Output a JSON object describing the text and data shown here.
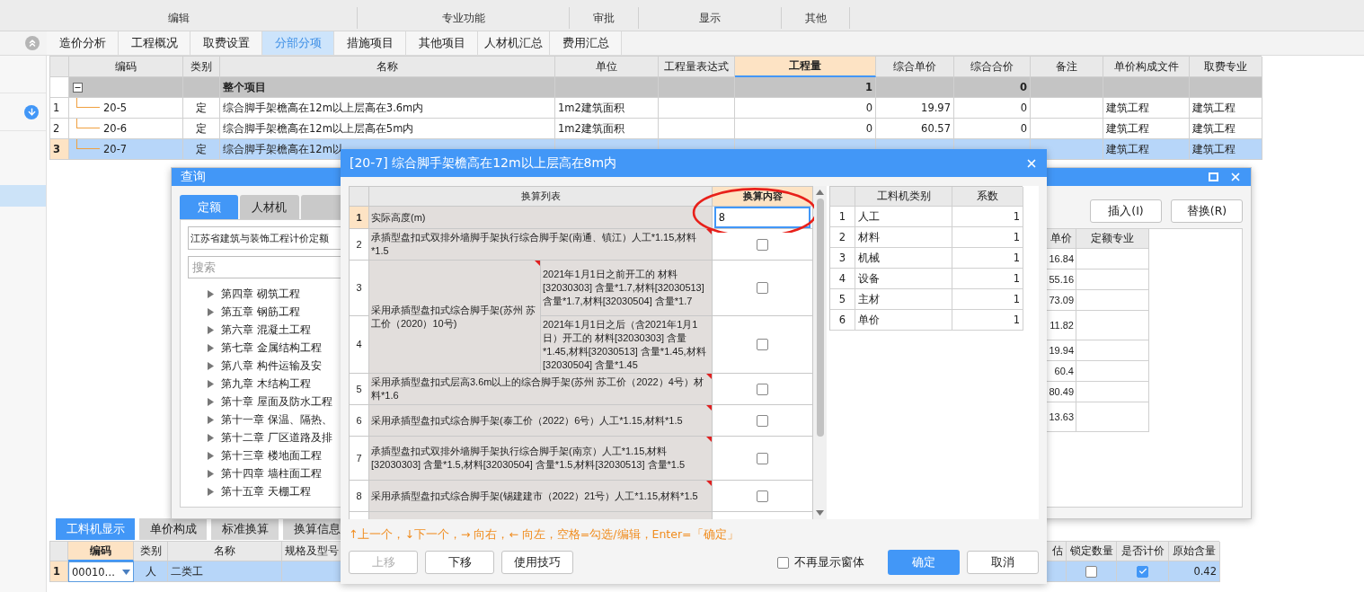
{
  "ribbon": {
    "groups": [
      {
        "label": "编辑"
      },
      {
        "label": "专业功能"
      },
      {
        "label": "审批"
      },
      {
        "label": "显示"
      },
      {
        "label": "其他"
      }
    ]
  },
  "tabs": [
    {
      "label": "造价分析",
      "selected": false
    },
    {
      "label": "工程概况",
      "selected": false
    },
    {
      "label": "取费设置",
      "selected": false
    },
    {
      "label": "分部分项",
      "selected": true
    },
    {
      "label": "措施项目",
      "selected": false
    },
    {
      "label": "其他项目",
      "selected": false
    },
    {
      "label": "人材机汇总",
      "selected": false
    },
    {
      "label": "费用汇总",
      "selected": false
    }
  ],
  "main_table": {
    "columns": [
      {
        "selected": false
      },
      {
        "label": "编码",
        "selected": false
      },
      {
        "label": "类别",
        "selected": false
      },
      {
        "label": "名称",
        "selected": false
      },
      {
        "label": "单位",
        "selected": false
      },
      {
        "label": "工程量表达式",
        "selected": false
      },
      {
        "label": "工程量",
        "selected": true
      },
      {
        "label": "综合单价",
        "selected": false
      },
      {
        "label": "综合合价",
        "selected": false
      },
      {
        "label": "备注",
        "selected": false
      },
      {
        "label": "单价构成文件",
        "selected": false
      },
      {
        "label": "取费专业",
        "selected": false
      }
    ],
    "total_row": {
      "label": "整个项目",
      "expanded": true,
      "quantity": "1",
      "total_price": "0"
    },
    "rows": [
      {
        "num": "1",
        "code": "20-5",
        "type": "定",
        "name": "综合脚手架檐高在12m以上层高在3.6m内",
        "unit": "1m2建筑面积",
        "quantity": "0",
        "unit_price": "19.97",
        "total_price": "0",
        "price_file": "建筑工程",
        "fee_type": "建筑工程",
        "selected": false
      },
      {
        "num": "2",
        "code": "20-6",
        "type": "定",
        "name": "综合脚手架檐高在12m以上层高在5m内",
        "unit": "1m2建筑面积",
        "quantity": "0",
        "unit_price": "60.57",
        "total_price": "0",
        "price_file": "建筑工程",
        "fee_type": "建筑工程",
        "selected": false
      },
      {
        "num": "3",
        "code": "20-7",
        "type": "定",
        "name": "综合脚手架檐高在12m以",
        "price_file": "建筑工程",
        "fee_type": "建筑工程",
        "selected": true
      }
    ]
  },
  "query_window": {
    "title": "查询",
    "tabs": [
      {
        "label": "定额",
        "selected": true
      },
      {
        "label": "人材机",
        "selected": false
      },
      {
        "selected": false
      }
    ],
    "library": "江苏省建筑与装饰工程计价定额",
    "search": {
      "placeholder": "搜索"
    },
    "tree": [
      {
        "label": "第四章 砌筑工程",
        "expanded": false
      },
      {
        "label": "第五章 钢筋工程",
        "expanded": false
      },
      {
        "label": "第六章 混凝土工程",
        "expanded": false
      },
      {
        "label": "第七章 金属结构工程",
        "expanded": false
      },
      {
        "label": "第八章 构件运输及安",
        "expanded": false
      },
      {
        "label": "第九章 木结构工程",
        "expanded": false
      },
      {
        "label": "第十章 屋面及防水工程",
        "expanded": false
      },
      {
        "label": "第十一章 保温、隔热、",
        "expanded": false
      },
      {
        "label": "第十二章 厂区道路及排",
        "expanded": false
      },
      {
        "label": "第十三章 楼地面工程",
        "expanded": false
      },
      {
        "label": "第十四章 墙柱面工程",
        "expanded": false
      },
      {
        "label": "第十五章 天棚工程",
        "expanded": false
      }
    ],
    "buttons": [
      "插入(I)",
      "替换(R)"
    ],
    "table": {
      "columns": [
        "单价",
        "定额专业"
      ],
      "rows": [
        {
          "unit_price": "16.84"
        },
        {
          "unit_price": "55.16"
        },
        {
          "unit_price": "73.09"
        },
        {
          "unit_price": "11.82"
        },
        {
          "unit_price": "19.94"
        },
        {
          "unit_price": "60.4"
        },
        {
          "unit_price": "80.49"
        },
        {
          "unit_price": "13.63"
        }
      ]
    }
  },
  "dialog": {
    "title": "[20-7] 综合脚手架檐高在12m以上层高在8m内",
    "columns": [
      {
        "label": "换算列表",
        "selected": false
      },
      {
        "label": "换算内容",
        "selected": true
      }
    ],
    "conversions": [
      {
        "kind": "input",
        "num": "1",
        "text": "实际高度(m)",
        "value": "8",
        "selected": true
      },
      {
        "kind": "check",
        "num": "2",
        "text": "承插型盘扣式双排外墙脚手架执行综合脚手架(南通、镇江）人工*1.15,材料*1.5",
        "checked": false,
        "selected": false
      },
      {
        "kind": "group",
        "text": "采用承插型盘扣式综合脚手架(苏州 苏工价（2020）10号)",
        "children": [
          {
            "num": "3",
            "text": "2021年1月1日之前开工的 材料[32030303] 含量*1.7,材料[32030513] 含量*1.7,材料[32030504] 含量*1.7",
            "checked": false,
            "selected": false
          },
          {
            "num": "4",
            "text": "2021年1月1日之后（含2021年1月1日）开工的 材料[32030303] 含量*1.45,材料[32030513] 含量*1.45,材料[32030504] 含量*1.45",
            "checked": false,
            "selected": false
          }
        ]
      },
      {
        "kind": "check",
        "num": "5",
        "text": "采用承插型盘扣式层高3.6m以上的综合脚手架(苏州 苏工价（2022）4号）材料*1.6",
        "checked": false,
        "selected": false
      },
      {
        "kind": "check",
        "num": "6",
        "text": "采用承插型盘扣式综合脚手架(泰工价（2022）6号）人工*1.15,材料*1.5",
        "checked": false,
        "selected": false
      },
      {
        "kind": "check",
        "num": "7",
        "text": "承插型盘扣式双排外墙脚手架执行综合脚手架(南京）人工*1.15,材料[32030303] 含量*1.5,材料[32030504] 含量*1.5,材料[32030513] 含量*1.5",
        "checked": false,
        "selected": false
      },
      {
        "kind": "check",
        "num": "8",
        "text": "采用承插型盘扣式综合脚手架(锡建建市（2022）21号）人工*1.15,材料*1.5",
        "checked": false,
        "selected": false
      }
    ],
    "factor_table": {
      "columns": [
        "工料机类别",
        "系数"
      ],
      "rows": [
        {
          "num": "1",
          "category": "人工",
          "factor": "1"
        },
        {
          "num": "2",
          "category": "材料",
          "factor": "1"
        },
        {
          "num": "3",
          "category": "机械",
          "factor": "1"
        },
        {
          "num": "4",
          "category": "设备",
          "factor": "1"
        },
        {
          "num": "5",
          "category": "主材",
          "factor": "1"
        },
        {
          "num": "6",
          "category": "单价",
          "factor": "1"
        }
      ]
    },
    "hint": "↑上一个，↓下一个，→ 向右，← 向左，空格=勾选/编辑，Enter=「确定」",
    "buttons": [
      {
        "label": "上移",
        "disabled": true
      },
      {
        "label": "下移",
        "disabled": false
      },
      {
        "label": "使用技巧",
        "disabled": false
      }
    ],
    "dont_show": {
      "label": "不再显示窗体",
      "checked": false
    },
    "confirm": "确定",
    "cancel": "取消"
  },
  "bottom_panel": {
    "tabs": [
      {
        "label": "工料机显示",
        "selected": true
      },
      {
        "label": "单价构成",
        "selected": false
      },
      {
        "label": "标准换算",
        "selected": false
      },
      {
        "label": "换算信息",
        "selected": false
      }
    ],
    "left_columns": [
      {
        "selected": false
      },
      {
        "label": "编码",
        "selected": true
      },
      {
        "label": "类别",
        "selected": false
      },
      {
        "label": "名称",
        "selected": false
      },
      {
        "label": "规格及型号",
        "selected": false
      }
    ],
    "right_columns": [
      "估",
      "锁定数量",
      "是否计价",
      "原始含量"
    ],
    "rows": [
      {
        "num": "1",
        "code": "00010…",
        "type": "人",
        "name": "二类工",
        "locked": false,
        "priced": true,
        "original_amount": "0.42",
        "selected": true
      }
    ]
  }
}
